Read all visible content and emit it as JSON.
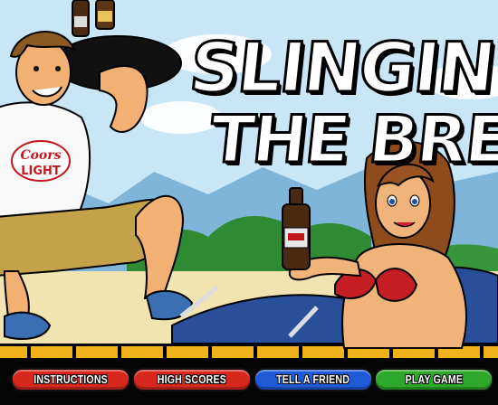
{
  "game": {
    "title_line_1": "SLINGIN'",
    "title_line_2": "THE BREW",
    "shirt_logo_line_1": "Coors",
    "shirt_logo_line_2": "LIGHT"
  },
  "menu": {
    "buttons": [
      {
        "label": "INSTRUCTIONS",
        "color": "#d8281e"
      },
      {
        "label": "HIGH SCORES",
        "color": "#d8281e"
      },
      {
        "label": "TELL A FRIEND",
        "color": "#1f5bd6"
      },
      {
        "label": "PLAY GAME",
        "color": "#2ea82a"
      }
    ]
  },
  "colors": {
    "sky": "#c9e6f7",
    "hills": "#2e8a33",
    "sand": "#f1e4b0",
    "menu_bg": "#050505"
  }
}
